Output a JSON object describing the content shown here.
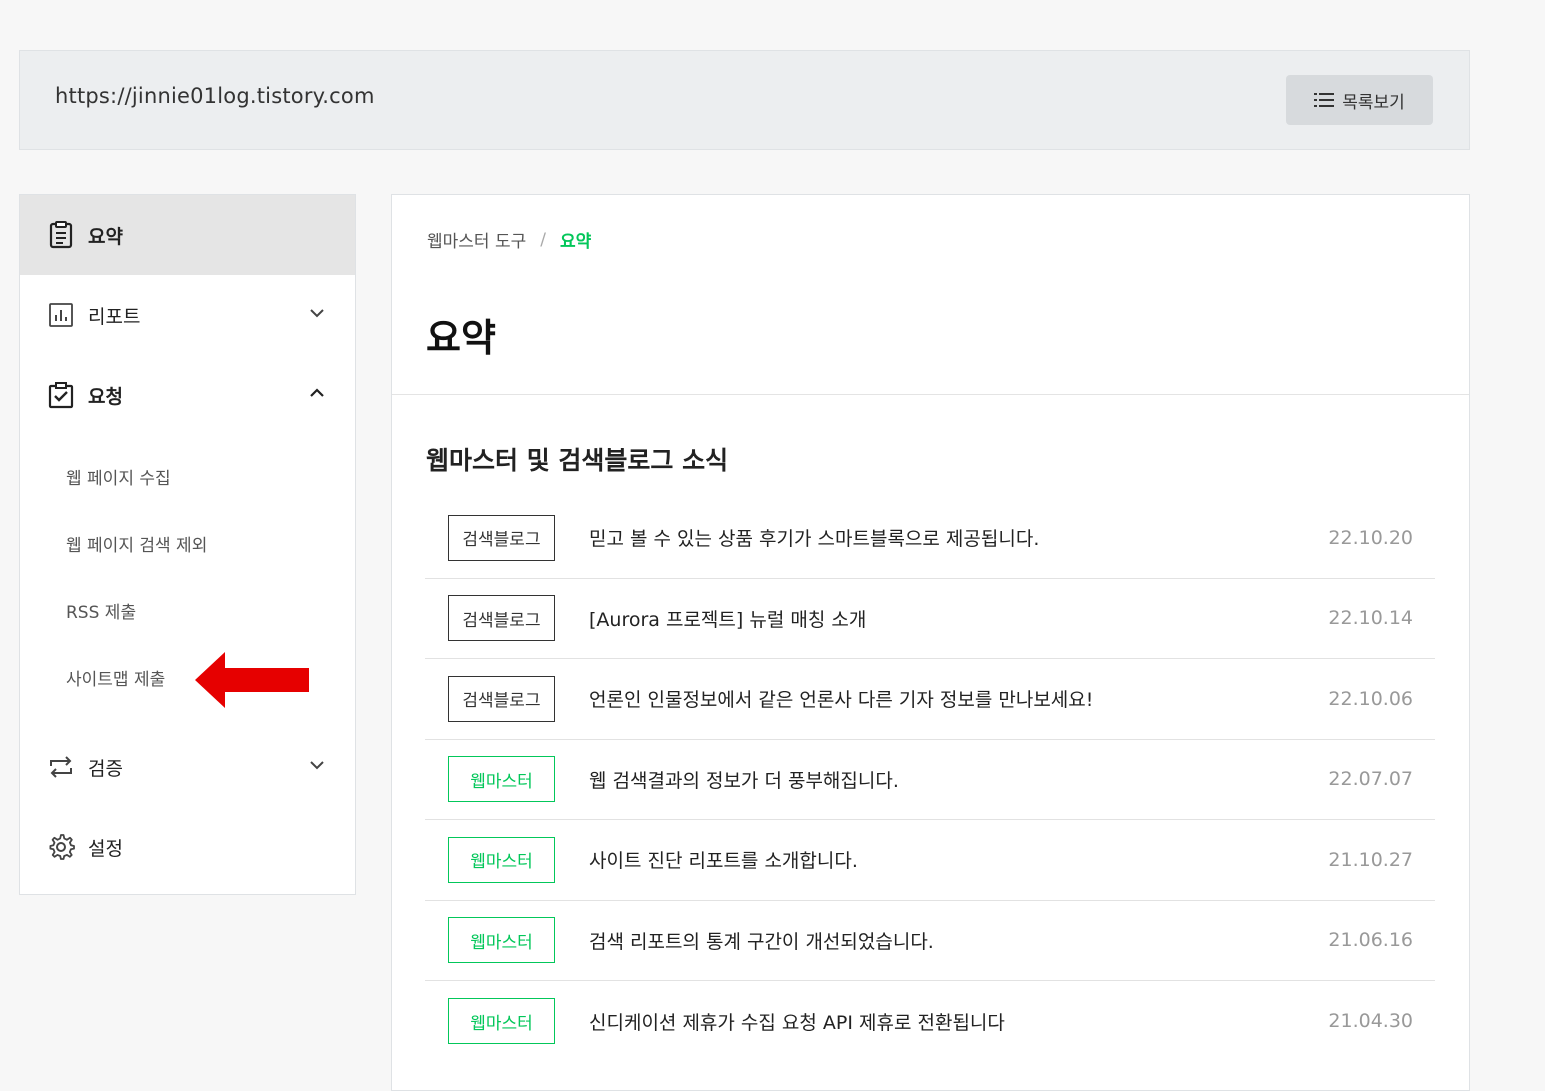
{
  "header": {
    "site_url": "https://jinnie01log.tistory.com",
    "list_button_label": "목록보기"
  },
  "sidebar": {
    "items": [
      {
        "label": "요약",
        "icon": "clipboard-icon",
        "active": true
      },
      {
        "label": "리포트",
        "icon": "bar-chart-icon",
        "expanded": false
      },
      {
        "label": "요청",
        "icon": "checkbox-icon",
        "expanded": true
      },
      {
        "label": "검증",
        "icon": "repeat-icon",
        "expanded": false
      },
      {
        "label": "설정",
        "icon": "gear-icon"
      }
    ],
    "sub_items": [
      {
        "label": "웹 페이지 수집"
      },
      {
        "label": "웹 페이지 검색 제외"
      },
      {
        "label": "RSS 제출"
      },
      {
        "label": "사이트맵 제출"
      }
    ]
  },
  "main": {
    "breadcrumb": {
      "parent": "웹마스터 도구",
      "separator": "/",
      "current": "요약"
    },
    "title": "요약",
    "section_title": "웹마스터 및 검색블로그 소식",
    "news": [
      {
        "tag": "검색블로그",
        "tag_style": "dark",
        "title": "믿고 볼 수 있는 상품 후기가 스마트블록으로 제공됩니다.",
        "date": "22.10.20"
      },
      {
        "tag": "검색블로그",
        "tag_style": "dark",
        "title": "[Aurora 프로젝트] 뉴럴 매칭 소개",
        "date": "22.10.14"
      },
      {
        "tag": "검색블로그",
        "tag_style": "dark",
        "title": "언론인 인물정보에서 같은 언론사 다른 기자 정보를 만나보세요!",
        "date": "22.10.06"
      },
      {
        "tag": "웹마스터",
        "tag_style": "green",
        "title": "웹 검색결과의 정보가 더 풍부해집니다.",
        "date": "22.07.07"
      },
      {
        "tag": "웹마스터",
        "tag_style": "green",
        "title": "사이트 진단 리포트를 소개합니다.",
        "date": "21.10.27"
      },
      {
        "tag": "웹마스터",
        "tag_style": "green",
        "title": "검색 리포트의 통계 구간이 개선되었습니다.",
        "date": "21.06.16"
      },
      {
        "tag": "웹마스터",
        "tag_style": "green",
        "title": "신디케이션 제휴가 수집 요청 API 제휴로 전환됩니다",
        "date": "21.04.30"
      }
    ]
  },
  "colors": {
    "accent_green": "#03c75a",
    "annotation_arrow": "#e60000"
  }
}
